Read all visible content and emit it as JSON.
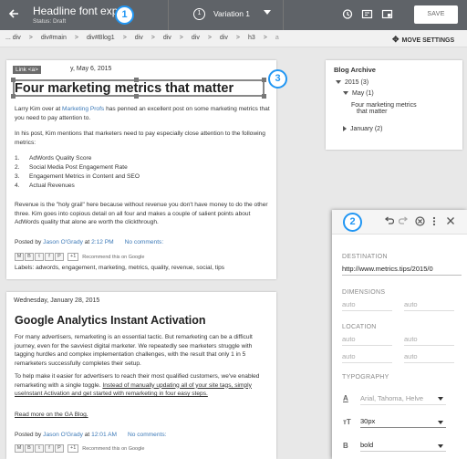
{
  "header": {
    "back_icon": "arrow-left-icon",
    "title": "Headline font exp",
    "status": "Status: Draft",
    "badge_1": "1",
    "variation_number": "1",
    "variation_label": "Variation 1",
    "save_label": "SAVE"
  },
  "breadcrumb": {
    "items": [
      "... div",
      ">",
      "div#main",
      ">",
      "div#Blog1",
      ">",
      "div",
      ">",
      "div",
      ">",
      "div",
      ">",
      "div",
      ">",
      "h3",
      ">",
      "a"
    ],
    "move_label": "MOVE SETTINGS"
  },
  "post1": {
    "link_tag": "Link <a>",
    "date_visible": "y, May 6, 2015",
    "badge_3": "3",
    "title": "Four marketing metrics that matter",
    "para1_a": "Larry Kim over at ",
    "para1_link": "Marketing Profs",
    "para1_b": " has penned an excellent post on some marketing metrics that you need to pay attention to.",
    "para2": "In his post, Kim mentions that marketers need to pay especially close attention to the following metrics:",
    "list": [
      {
        "n": "1.",
        "t": "AdWords Quality Score"
      },
      {
        "n": "2.",
        "t": "Social Media Post Engagement Rate"
      },
      {
        "n": "3.",
        "t": "Engagement Metrics in Content and SEO"
      },
      {
        "n": "4.",
        "t": "Actual Revenues"
      }
    ],
    "para3": "Revenue is the \"holy grail\" here because without revenue you don't have money to do the other three. Kim goes into copious detail on all four and makes a couple of salient points about AdWords quality that alone are worth the clickthrough.",
    "posted_by": "Posted by ",
    "author": "Jason O'Grady",
    "at": " at ",
    "time": "2:12 PM",
    "comments": "No comments:",
    "plus_one": "+1",
    "recommend": "Recommend this on Google",
    "labels": "Labels: adwords, engagement, marketing, metrics, quality, revenue, social, tips"
  },
  "post2": {
    "date": "Wednesday, January 28, 2015",
    "title": "Google Analytics Instant Activation",
    "para1": "For many advertisers, remarketing is an essential tactic. But remarketing can be a difficult journey, even for the savviest digital marketer. We repeatedly see marketers struggle with tagging hurdles and complex implementation challenges, with the result that only 1 in 5 remarketers successfully completes their setup.",
    "para2_a": "To help make it easier for advertisers to reach their most qualified customers, we've enabled remarketing with a single toggle. ",
    "para2_u": "Instead of manually updating all of your site tags, simply useInstant Activation and get started with remarketing in four easy steps.",
    "read_more": "Read more on the GA Blog.",
    "posted_by": "Posted by ",
    "author": "Jason O'Grady",
    "at": " at ",
    "time": "12:01 AM",
    "comments": "No comments:",
    "plus_one": "+1",
    "recommend": "Recommend this on Google"
  },
  "archive": {
    "title": "Blog Archive",
    "year": "2015 (3)",
    "month": "May (1)",
    "post_line1": "Four marketing metrics",
    "post_line2": "that matter",
    "jan": "January (2)"
  },
  "panel": {
    "badge_2": "2",
    "destination_label": "DESTINATION",
    "destination_value": "http://www.metrics.tips/2015/0",
    "dimensions_label": "DIMENSIONS",
    "width_placeholder": "auto",
    "height_placeholder": "auto",
    "location_label": "LOCATION",
    "loc": [
      "auto",
      "auto",
      "auto",
      "auto"
    ],
    "typography_label": "TYPOGRAPHY",
    "font_family": "Arial, Tahoma, Helve",
    "font_size": "30px",
    "font_weight": "bold"
  },
  "colors": {
    "header_bg": "#5f6368",
    "badge_blue": "#2196f3",
    "link_blue": "#3d7ab8"
  }
}
